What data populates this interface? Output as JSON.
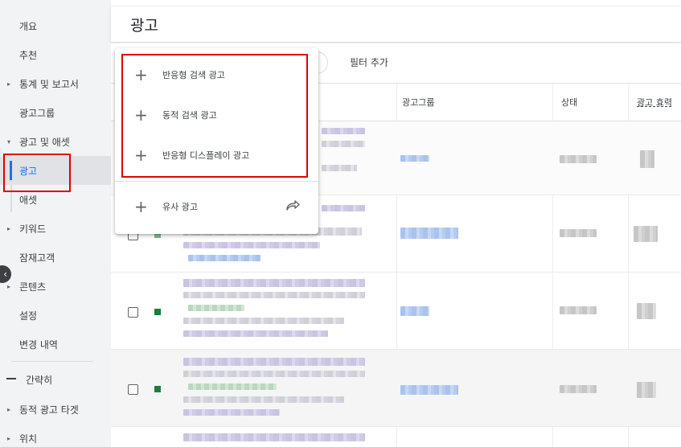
{
  "sidebar": {
    "items": [
      {
        "label": "개요",
        "arrow": ""
      },
      {
        "label": "추천",
        "arrow": ""
      },
      {
        "label": "통계 및 보고서",
        "arrow": "▸"
      },
      {
        "label": "광고그룹",
        "arrow": ""
      },
      {
        "label": "광고 및 애셋",
        "arrow": "▾"
      },
      {
        "label": "광고",
        "arrow": ""
      },
      {
        "label": "애셋",
        "arrow": ""
      },
      {
        "label": "키워드",
        "arrow": "▸"
      },
      {
        "label": "잠재고객",
        "arrow": ""
      },
      {
        "label": "콘텐츠",
        "arrow": "▸"
      },
      {
        "label": "설정",
        "arrow": ""
      },
      {
        "label": "변경 내역",
        "arrow": ""
      }
    ],
    "simple_label": "간략히",
    "lower_items": [
      {
        "label": "동적 광고 타겟",
        "arrow": "▸"
      },
      {
        "label": "위치",
        "arrow": "▸"
      }
    ],
    "collapse_icon": "‹"
  },
  "header": {
    "title": "광고"
  },
  "toolbar": {
    "filter_add": "필터 추가"
  },
  "table": {
    "columns": [
      "광고그룹",
      "상태",
      "광고 효력"
    ]
  },
  "menu": {
    "items": [
      {
        "label": "반응형 검색 광고",
        "icon": "plus-icon"
      },
      {
        "label": "동적 검색 광고",
        "icon": "plus-icon"
      },
      {
        "label": "반응형 디스플레이 광고",
        "icon": "plus-icon"
      }
    ],
    "extra": {
      "label": "유사 광고",
      "icon": "plus-icon",
      "trailing_icon": "share-arrow-icon"
    }
  },
  "colors": {
    "accent": "#1a73e8",
    "highlight": "#e00000",
    "status_green": "#188038"
  }
}
